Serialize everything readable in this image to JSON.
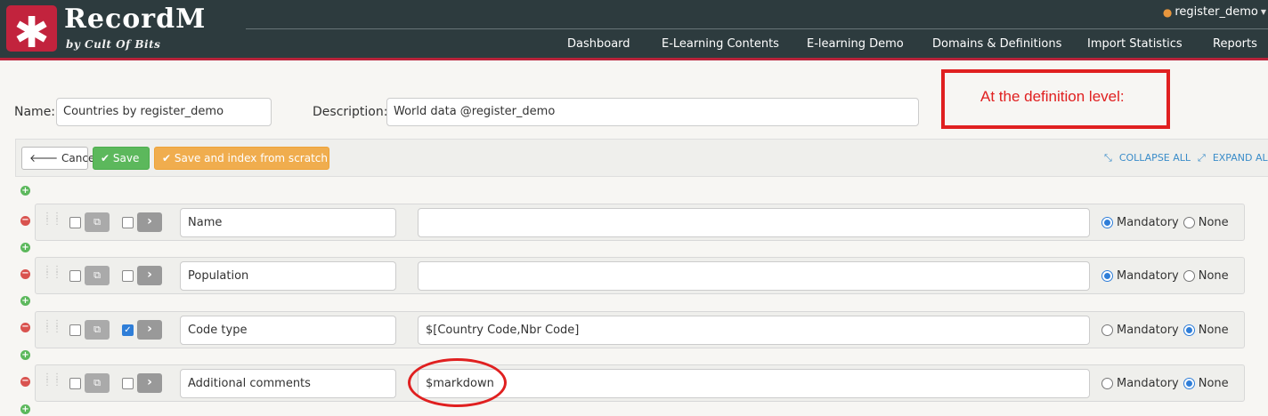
{
  "header": {
    "logo_glyph": "✱",
    "brand": "RecordM",
    "brand_sub": "by Cult Of Bits",
    "user": "register_demo",
    "nav": [
      "Dashboard",
      "E-Learning Contents",
      "E-learning Demo",
      "Domains & Definitions",
      "Import Statistics",
      "Reports"
    ]
  },
  "form": {
    "name_label": "Name:",
    "name_value": "Countries by register_demo",
    "description_label": "Description:",
    "description_value": "World data @register_demo"
  },
  "callout_text": "At the definition level:",
  "toolbar": {
    "cancel": "Cancel",
    "save": "Save",
    "save_index": "Save and index from scratch",
    "collapse_all": "COLLAPSE ALL",
    "expand_all": "EXPAND ALL"
  },
  "rows": [
    {
      "name": "Name",
      "type": "",
      "checked": false,
      "requirement": "Mandatory"
    },
    {
      "name": "Population",
      "type": "",
      "checked": false,
      "requirement": "Mandatory"
    },
    {
      "name": "Code type",
      "type": "$[Country Code,Nbr Code]",
      "checked": true,
      "requirement": "None"
    },
    {
      "name": "Additional comments",
      "type": "$markdown",
      "checked": false,
      "requirement": "None"
    }
  ],
  "radio_labels": {
    "mandatory": "Mandatory",
    "none": "None"
  },
  "colors": {
    "header_bg": "#2d3b3e",
    "brand_red": "#c2233d",
    "save_green": "#5cb85c",
    "index_orange": "#f0ad4e",
    "link_blue": "#3a8cc9",
    "annotation_red": "#e02020"
  }
}
